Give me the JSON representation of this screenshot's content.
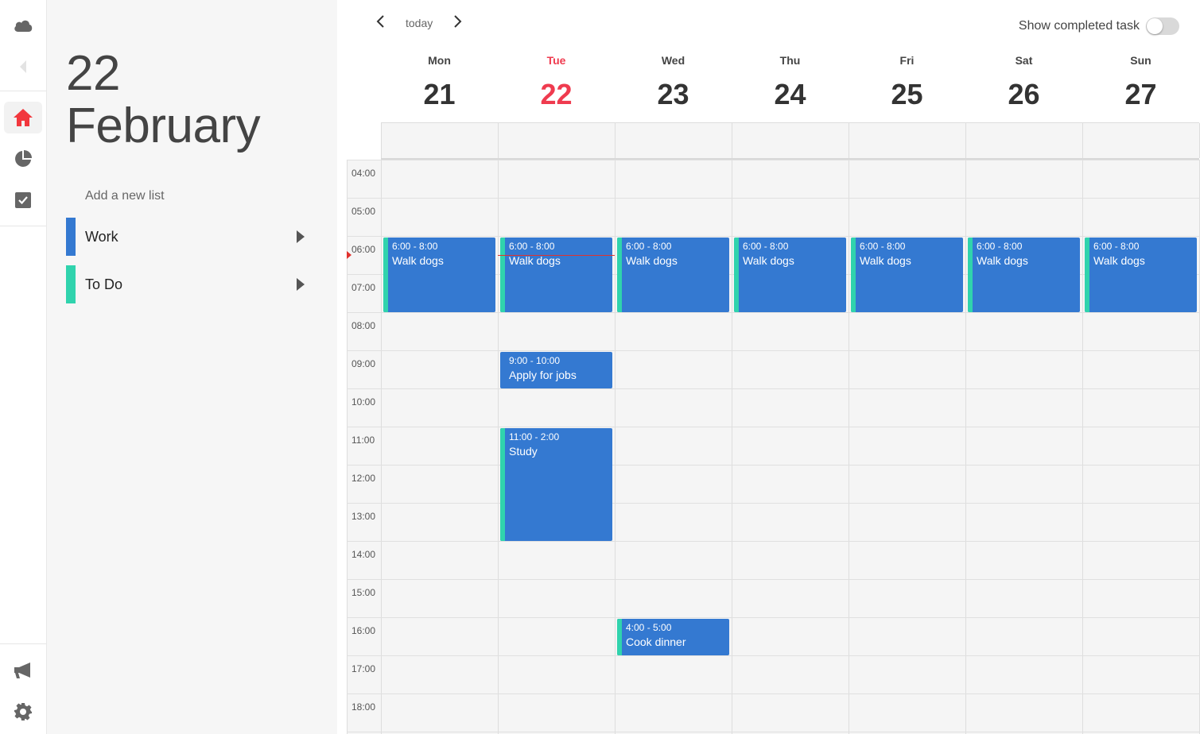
{
  "panel": {
    "day": "22",
    "month": "February",
    "add_list": "Add a new list",
    "lists": [
      {
        "label": "Work",
        "color": "#3479d1"
      },
      {
        "label": "To Do",
        "color": "#30d3ad"
      }
    ]
  },
  "nav": {
    "prev_icon": "chevron-left-icon",
    "today": "today",
    "next_icon": "chevron-right-icon"
  },
  "toggle": {
    "label": "Show completed task",
    "on": false
  },
  "days": [
    {
      "name": "Mon",
      "num": "21"
    },
    {
      "name": "Tue",
      "num": "22",
      "today": true
    },
    {
      "name": "Wed",
      "num": "23"
    },
    {
      "name": "Thu",
      "num": "24"
    },
    {
      "name": "Fri",
      "num": "25"
    },
    {
      "name": "Sat",
      "num": "26"
    },
    {
      "name": "Sun",
      "num": "27"
    }
  ],
  "hours": [
    "04:00",
    "05:00",
    "06:00",
    "07:00",
    "08:00",
    "09:00",
    "10:00",
    "11:00",
    "12:00",
    "13:00",
    "14:00",
    "15:00",
    "16:00",
    "17:00",
    "18:00"
  ],
  "events": [
    {
      "day": 0,
      "start": 6,
      "end": 8,
      "time": "6:00 - 8:00",
      "title": "Walk dogs"
    },
    {
      "day": 1,
      "start": 6,
      "end": 8,
      "time": "6:00 - 8:00",
      "title": "Walk dogs"
    },
    {
      "day": 2,
      "start": 6,
      "end": 8,
      "time": "6:00 - 8:00",
      "title": "Walk dogs"
    },
    {
      "day": 3,
      "start": 6,
      "end": 8,
      "time": "6:00 - 8:00",
      "title": "Walk dogs"
    },
    {
      "day": 4,
      "start": 6,
      "end": 8,
      "time": "6:00 - 8:00",
      "title": "Walk dogs"
    },
    {
      "day": 5,
      "start": 6,
      "end": 8,
      "time": "6:00 - 8:00",
      "title": "Walk dogs"
    },
    {
      "day": 6,
      "start": 6,
      "end": 8,
      "time": "6:00 - 8:00",
      "title": "Walk dogs"
    },
    {
      "day": 1,
      "start": 9,
      "end": 10,
      "time": "9:00 - 10:00",
      "title": "Apply for jobs",
      "noaccent": true
    },
    {
      "day": 1,
      "start": 11,
      "end": 14,
      "time": "11:00 - 2:00",
      "title": "Study"
    },
    {
      "day": 2,
      "start": 16,
      "end": 17,
      "time": "4:00 - 5:00",
      "title": "Cook dinner"
    }
  ],
  "now": {
    "day": 1,
    "hour": 6.5
  },
  "colors": {
    "accent": "#ef3b4f",
    "event": "#3479d1",
    "event_accent": "#30d3ad"
  }
}
